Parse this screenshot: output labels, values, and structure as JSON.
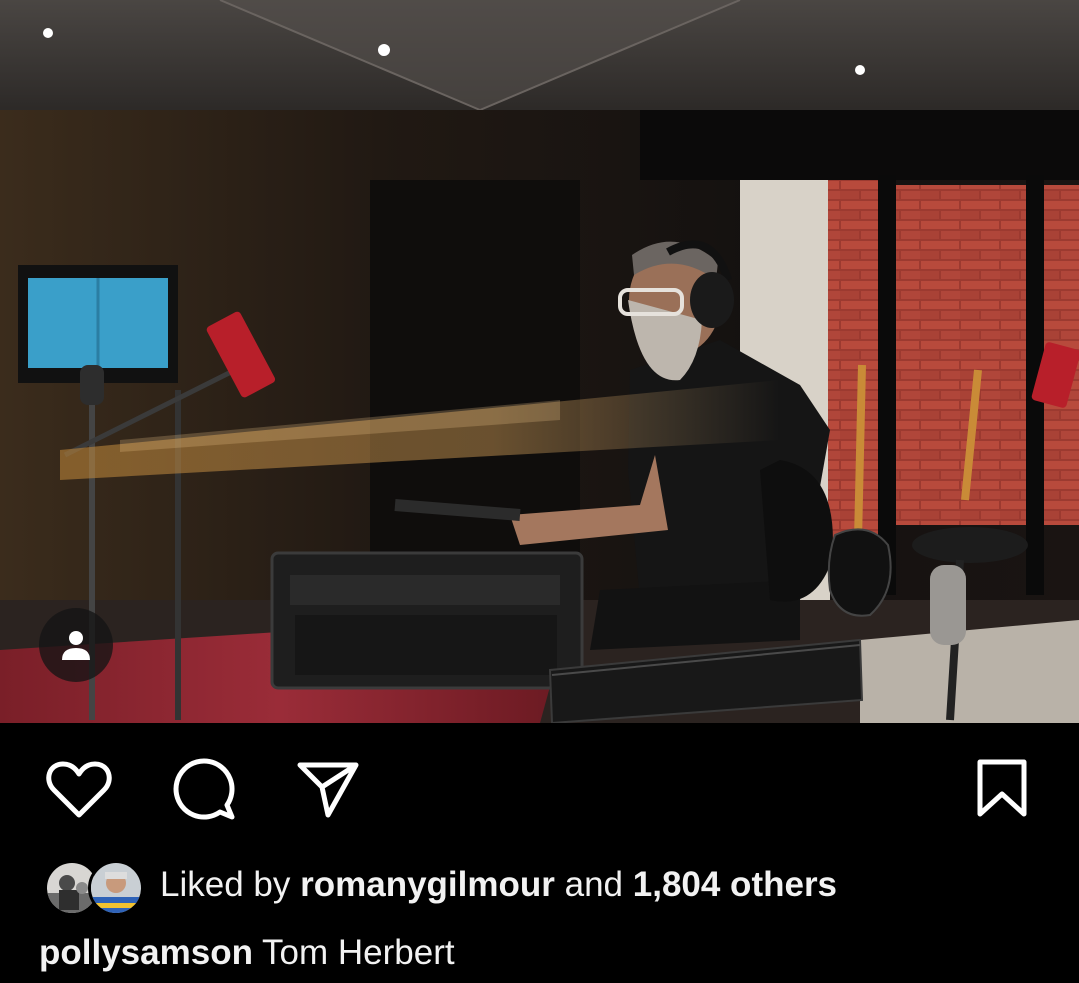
{
  "post": {
    "photo_icon": "person-icon",
    "accent": "#ffffff"
  },
  "actions": {
    "like_icon": "heart-icon",
    "comment_icon": "comment-bubble-icon",
    "share_icon": "paper-plane-icon",
    "save_icon": "bookmark-icon"
  },
  "likes": {
    "prefix": "Liked by",
    "user": "romanygilmour",
    "conjunction": "and",
    "others": "1,804 others"
  },
  "caption": {
    "username": "pollysamson",
    "text": "Tom Herbert"
  }
}
